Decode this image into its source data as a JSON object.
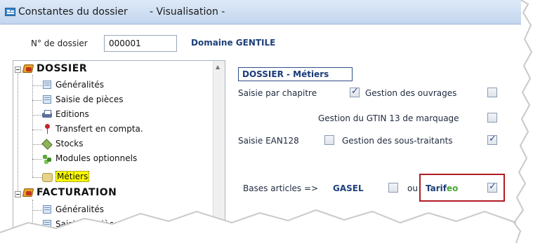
{
  "window": {
    "title": "Constantes du dossier       - Visualisation -"
  },
  "dossier": {
    "label": "N° de dossier",
    "value": "000001",
    "domain": "Domaine GENTILE"
  },
  "tree": {
    "nodes": [
      {
        "label": "DOSSIER",
        "type": "root",
        "icon": "folder-tools-icon"
      },
      {
        "label": "Généralités",
        "type": "child",
        "icon": "document-icon"
      },
      {
        "label": "Saisie de pièces",
        "type": "child",
        "icon": "document-icon"
      },
      {
        "label": "Editions",
        "type": "child",
        "icon": "printer-icon"
      },
      {
        "label": "Transfert en compta.",
        "type": "child",
        "icon": "pin-icon"
      },
      {
        "label": "Stocks",
        "type": "child",
        "icon": "stock-icon"
      },
      {
        "label": "Modules optionnels",
        "type": "child",
        "icon": "puzzle-icon"
      },
      {
        "label": "Métiers",
        "type": "child",
        "icon": "metiers-icon",
        "selected": true
      },
      {
        "label": "FACTURATION",
        "type": "root",
        "icon": "folder-tools-icon"
      },
      {
        "label": "Généralités",
        "type": "child",
        "icon": "document-icon"
      },
      {
        "label": "Saisie de pièces",
        "type": "child",
        "icon": "document-icon"
      }
    ]
  },
  "section": {
    "title": "DOSSIER - Métiers"
  },
  "options": {
    "saisie_chapitre": {
      "label": "Saisie par chapitre",
      "checked": true
    },
    "gestion_ouvrages": {
      "label": "Gestion des ouvrages",
      "checked": false
    },
    "gestion_gtin": {
      "label": "Gestion du GTIN 13 de marquage",
      "checked": false
    },
    "saisie_ean128": {
      "label": "Saisie EAN128",
      "checked": false
    },
    "gestion_sous_traitants": {
      "label": "Gestion des sous-traitants",
      "checked": true
    },
    "bases_articles": {
      "label": "Bases articles =>",
      "gasel": {
        "label": "GASEL",
        "checked": false
      },
      "ou": "ou",
      "tarifeo": {
        "label_main": "Tarif",
        "label_accent": "eo",
        "checked": true
      }
    }
  },
  "colors": {
    "accent_blue": "#1d3f7a",
    "tarifeo_green": "#4aa836",
    "highlight_red": "#b01c24"
  }
}
